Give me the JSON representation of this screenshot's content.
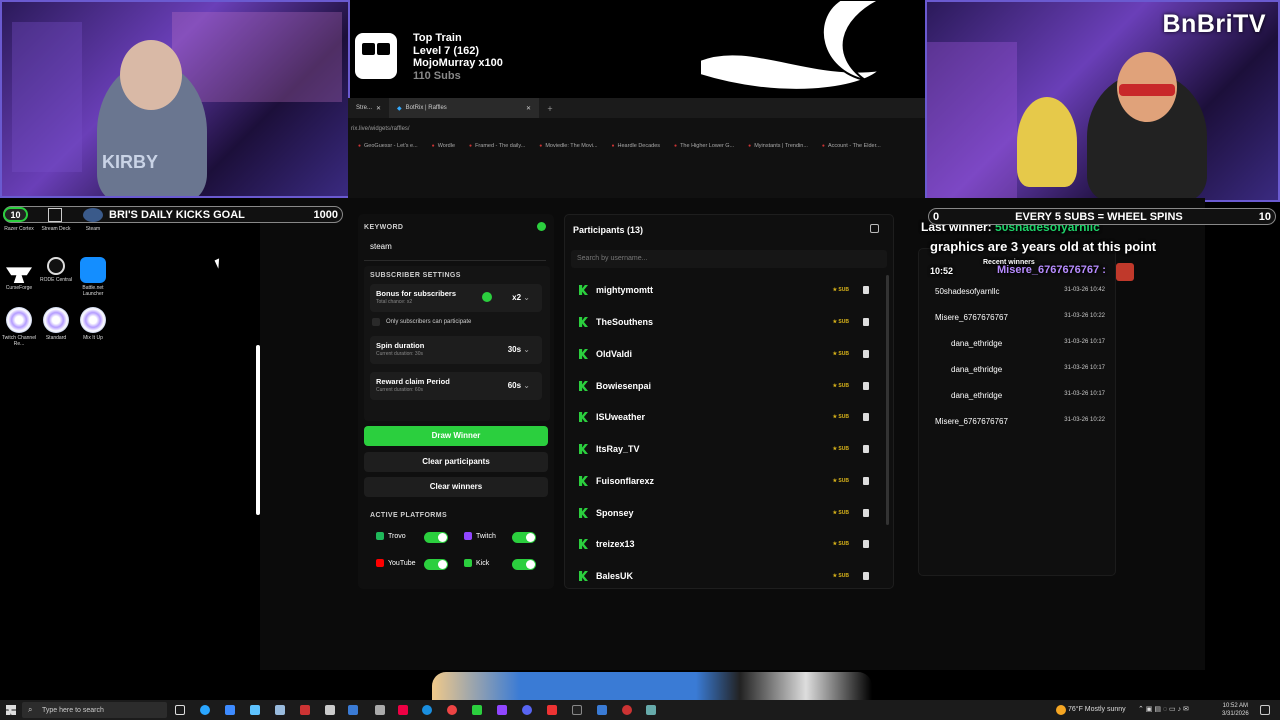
{
  "webcam_left": {
    "shirt_text": "KIRBY"
  },
  "webcam_right": {
    "brand": "BnBriTV"
  },
  "top_train": {
    "title": "Top Train",
    "level": "Level 7  (162)",
    "user": "MojoMurray x100",
    "subs": "110 Subs"
  },
  "browser": {
    "tabs": [
      {
        "label": "Stre..."
      },
      {
        "label": "BotRix | Raffles",
        "active": true
      }
    ],
    "url": "rix.live/widgets/raffles/",
    "bookmarks": [
      "GeoGuessr - Let's e...",
      "Wordle",
      "Framed - The daily...",
      "Moviedle: The Movi...",
      "Heardle Decades",
      "The Higher Lower G...",
      "Myinstants | Trendin...",
      "Account - The Elder..."
    ]
  },
  "desktop": {
    "mini_icons": [
      {
        "label": "Razer Cortex"
      },
      {
        "label": "Stream Deck"
      },
      {
        "label": "Steam"
      }
    ],
    "icons": [
      {
        "label": "CurseForge"
      },
      {
        "label": "RODE Central"
      },
      {
        "label": "Battle.net Launcher"
      },
      {
        "label": "Twitch Channel Re..."
      },
      {
        "label": "Standard"
      },
      {
        "label": "Mix It Up"
      }
    ],
    "mini_counter": "10"
  },
  "goal_left": {
    "title": "BRI'S DAILY KICKS GOAL",
    "target": "1000"
  },
  "goal_right": {
    "start": "0",
    "title": "EVERY 5 SUBS = WHEEL SPINS",
    "end": "10"
  },
  "raffle": {
    "keyword_label": "KEYWORD",
    "keyword_value": "steam",
    "subscriber_settings_label": "SUBSCRIBER SETTINGS",
    "bonus_label": "Bonus for subscribers",
    "bonus_sub": "Total chance: x2",
    "bonus_value": "x2",
    "only_subs_label": "Only subscribers can participate",
    "spin_label": "Spin duration",
    "spin_sub": "Current duration: 30s",
    "spin_value": "30s",
    "reward_label": "Reward claim Period",
    "reward_sub": "Current duration: 60s",
    "reward_value": "60s",
    "draw_button": "Draw Winner",
    "clear_participants_button": "Clear participants",
    "clear_winners_button": "Clear winners",
    "active_platforms_label": "ACTIVE PLATFORMS",
    "platforms": [
      {
        "name": "Trovo",
        "color": "#1fb85a"
      },
      {
        "name": "Twitch",
        "color": "#9146ff"
      },
      {
        "name": "YouTube",
        "color": "#ff0000"
      },
      {
        "name": "Kick",
        "color": "#2bcf3e"
      }
    ]
  },
  "participants": {
    "title": "Participants (13)",
    "search_placeholder": "Search by username...",
    "sub_badge": "★ SUB",
    "list": [
      "mightymomtt",
      "TheSouthens",
      "OldValdi",
      "Bowiesenpai",
      "ISUweather",
      "ItsRay_TV",
      "Fuisonflarexz",
      "Sponsey",
      "treizex13",
      "BalesUK"
    ]
  },
  "winners": {
    "last_winner_label": "Last winner:",
    "last_winner_name": "50shadesofyarnllc",
    "chat_line": "graphics are 3 years old at this point",
    "chat_time": "10:52",
    "chat_user": "Misere_6767676767 :",
    "recent_label": "Recent winners",
    "list": [
      {
        "name": "50shadesofyarnllc",
        "date": "31-03-26 10:42"
      },
      {
        "name": "Misere_6767676767",
        "date": "31-03-26 10:22"
      },
      {
        "name": "dana_ethridge",
        "date": "31-03-26 10:17"
      },
      {
        "name": "dana_ethridge",
        "date": "31-03-26 10:17"
      },
      {
        "name": "dana_ethridge",
        "date": "31-03-26 10:17"
      },
      {
        "name": "Misere_6767676767",
        "date": "31-03-26 10:22"
      }
    ]
  },
  "taskbar": {
    "search_placeholder": "Type here to search",
    "weather": "76°F  Mostly sunny",
    "time": "10:52 AM",
    "date": "3/31/2026"
  },
  "colors": {
    "accent_green": "#2bcf3e",
    "sub_gold": "#d8b31a",
    "winner_green": "#1fd36a"
  }
}
